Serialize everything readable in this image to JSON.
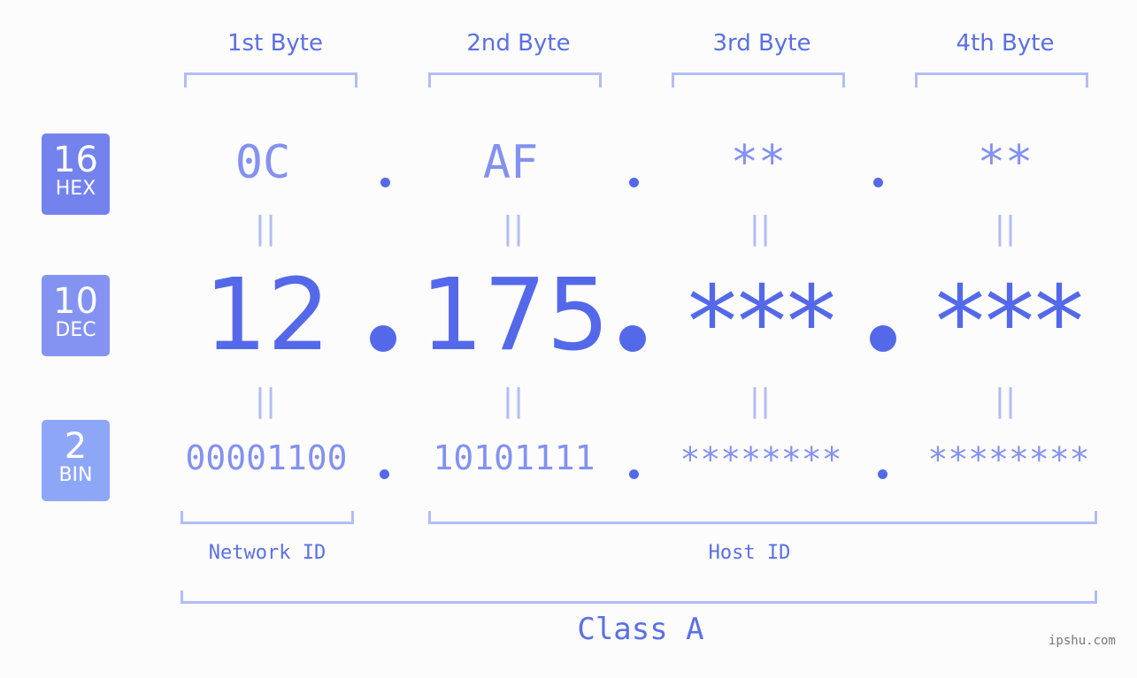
{
  "headers": [
    "1st Byte",
    "2nd Byte",
    "3rd Byte",
    "4th Byte"
  ],
  "badges": {
    "hex": {
      "number": "16",
      "label": "HEX",
      "color": "#7382ed"
    },
    "dec": {
      "number": "10",
      "label": "DEC",
      "color": "#8493f2"
    },
    "bin": {
      "number": "2",
      "label": "BIN",
      "color": "#8ea6f8"
    }
  },
  "hex": [
    "0C",
    "AF",
    "**",
    "**"
  ],
  "dec": [
    "12",
    "175",
    "***",
    "***"
  ],
  "bin": [
    "00001100",
    "10101111",
    "********",
    "********"
  ],
  "equals": "||",
  "network_label": "Network ID",
  "host_label": "Host ID",
  "class_label": "Class A",
  "watermark": "ipshu.com",
  "colors": {
    "accent": "#5469ea",
    "bracket": "#b3bcf6",
    "light": "#8491f0"
  }
}
